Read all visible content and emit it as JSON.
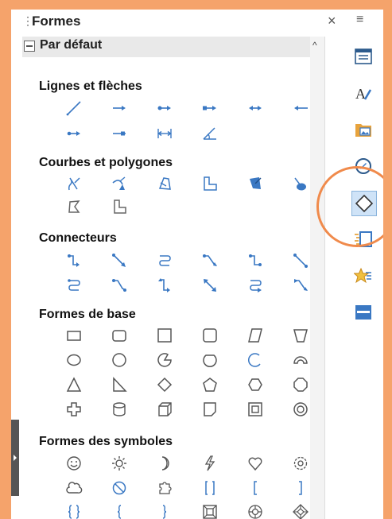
{
  "header": {
    "title": "Formes",
    "close": "×",
    "menu": "≡"
  },
  "category": {
    "label": "Par défaut",
    "scroll_up": "^"
  },
  "sections": {
    "lines": "Lignes et flèches",
    "curves": "Courbes et polygones",
    "connectors": "Connecteurs",
    "basic": "Formes de base",
    "symbols": "Formes des symboles"
  },
  "colors": {
    "accent": "#3a78c3",
    "icon_gray": "#6b6b6b",
    "highlight": "#f08a4b"
  }
}
